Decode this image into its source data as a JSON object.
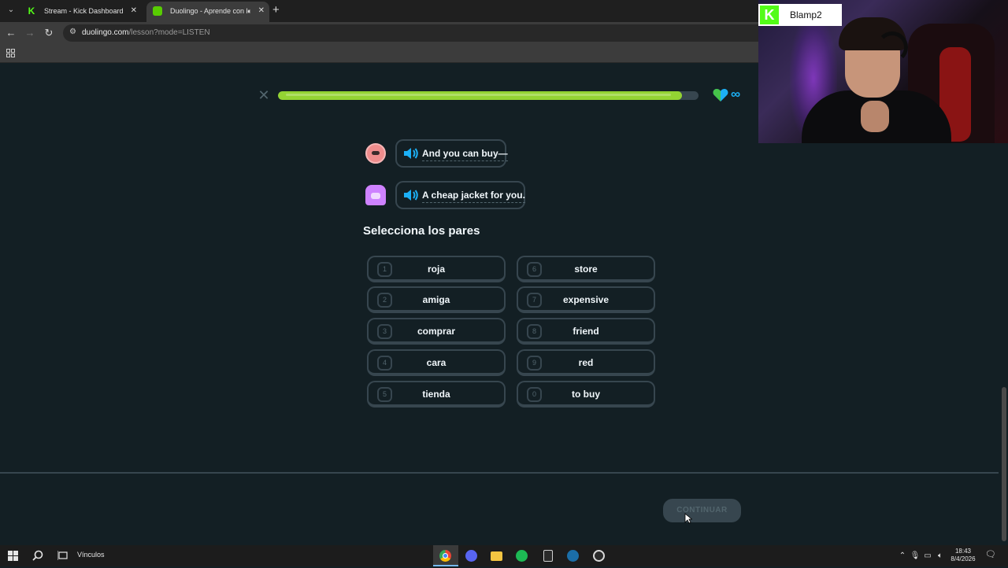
{
  "browser": {
    "tabs": [
      {
        "title": "Stream - Kick Dashboard",
        "active": false
      },
      {
        "title": "Duolingo - Aprende con lecciones",
        "active": true
      }
    ],
    "new_tab": "+",
    "url_host": "duolingo.com",
    "url_path": "/lesson?mode=LISTEN",
    "icons": {
      "back": "arrow-left-icon",
      "forward": "arrow-right-icon",
      "reload": "reload-icon",
      "apps": "apps-grid-icon"
    }
  },
  "lesson": {
    "progress": 0.96,
    "lives": "∞",
    "dialogue": [
      {
        "speaker": "red-character",
        "text": "And you can buy—"
      },
      {
        "speaker": "purple-character",
        "text": "A cheap jacket for you."
      }
    ],
    "prompt": "Selecciona los pares",
    "left_words": [
      {
        "num": "1",
        "word": "roja"
      },
      {
        "num": "2",
        "word": "amiga"
      },
      {
        "num": "3",
        "word": "comprar"
      },
      {
        "num": "4",
        "word": "cara"
      },
      {
        "num": "5",
        "word": "tienda"
      }
    ],
    "right_words": [
      {
        "num": "6",
        "word": "store"
      },
      {
        "num": "7",
        "word": "expensive"
      },
      {
        "num": "8",
        "word": "friend"
      },
      {
        "num": "9",
        "word": "red"
      },
      {
        "num": "0",
        "word": "to buy"
      }
    ],
    "continue_label": "CONTINUAR",
    "colors": {
      "progress": "#93d333",
      "heart": "#1cb0f6",
      "background": "#131f24",
      "border": "#37464f"
    }
  },
  "webcam": {
    "username": "Blamp2",
    "platform_logo": "K"
  },
  "taskbar": {
    "links_label": "Vínculos",
    "clock_time": "18:43",
    "clock_date": "8/4/2026",
    "apps": [
      "chrome",
      "discord",
      "file-explorer",
      "spotify",
      "epic-games",
      "steam",
      "obs"
    ]
  }
}
